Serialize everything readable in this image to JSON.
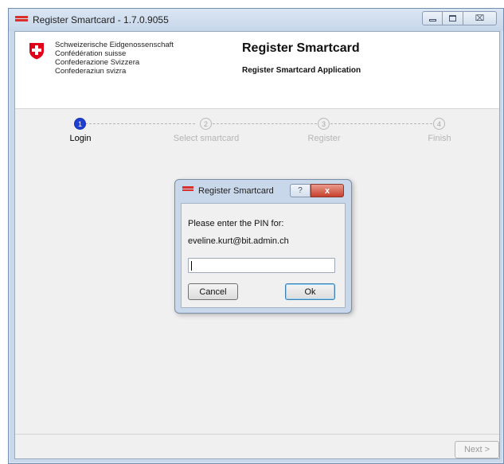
{
  "window": {
    "title": "Register Smartcard - 1.7.0.9055",
    "controls": {
      "minimize": "minimize",
      "maximize": "maximize",
      "close": "⌧"
    }
  },
  "header": {
    "confederation_lines": [
      "Schweizerische Eidgenossenschaft",
      "Confédération suisse",
      "Confederazione Svizzera",
      "Confederaziun svizra"
    ],
    "title": "Register Smartcard",
    "subtitle": "Register Smartcard Application"
  },
  "steps": [
    {
      "number": "1",
      "label": "Login",
      "active": true
    },
    {
      "number": "2",
      "label": "Select smartcard",
      "active": false
    },
    {
      "number": "3",
      "label": "Register",
      "active": false
    },
    {
      "number": "4",
      "label": "Finish",
      "active": false
    }
  ],
  "footer": {
    "next_label": "Next >",
    "next_enabled": false
  },
  "dialog": {
    "title": "Register Smartcard",
    "help": "?",
    "close": "x",
    "prompt": "Please enter the PIN for:",
    "account": "eveline.kurt@bit.admin.ch",
    "pin_value": "",
    "cancel_label": "Cancel",
    "ok_label": "Ok"
  },
  "colors": {
    "accent_active_step": "#1f3fd1",
    "flag_red": "#d9302b",
    "close_red": "#c7402c"
  },
  "icons": {
    "app": "swiss-flag-icon",
    "logo": "swiss-cross-shield-icon"
  }
}
